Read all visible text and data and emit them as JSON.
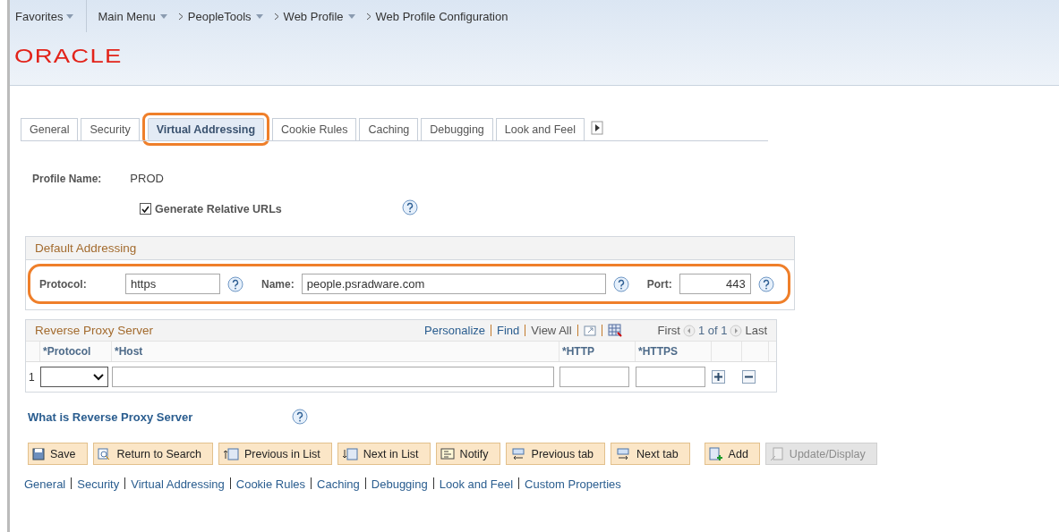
{
  "breadcrumb": {
    "favorites": "Favorites",
    "items": [
      {
        "label": "Main Menu",
        "dropdown": true
      },
      {
        "label": "PeopleTools",
        "dropdown": true
      },
      {
        "label": "Web Profile",
        "dropdown": true
      },
      {
        "label": "Web Profile Configuration",
        "dropdown": false
      }
    ]
  },
  "logo": "ORACLE",
  "tabs": [
    {
      "label": "General",
      "selected": false
    },
    {
      "label": "Security",
      "selected": false
    },
    {
      "label": "Virtual Addressing",
      "selected": true
    },
    {
      "label": "Cookie Rules",
      "selected": false
    },
    {
      "label": "Caching",
      "selected": false
    },
    {
      "label": "Debugging",
      "selected": false
    },
    {
      "label": "Look and Feel",
      "selected": false
    }
  ],
  "profile": {
    "label": "Profile Name:",
    "value": "PROD"
  },
  "relative_urls": {
    "label": "Generate Relative URLs",
    "checked": true
  },
  "default_addressing": {
    "title": "Default Addressing",
    "protocol_label": "Protocol:",
    "protocol": "https",
    "name_label": "Name:",
    "name": "people.psradware.com",
    "port_label": "Port:",
    "port": "443"
  },
  "proxy_grid": {
    "title": "Reverse Proxy Server",
    "links": [
      "Personalize",
      "Find",
      "View All"
    ],
    "first": "First",
    "count": "1 of 1",
    "last": "Last",
    "columns": [
      "*Protocol",
      "*Host",
      "*HTTP",
      "*HTTPS"
    ],
    "rows": [
      {
        "number": "1"
      }
    ]
  },
  "help_link": "What is Reverse Proxy Server",
  "buttons": [
    {
      "label": "Save",
      "kind": "save",
      "disabled": false
    },
    {
      "label": "Return to Search",
      "kind": "search",
      "disabled": false
    },
    {
      "label": "Previous in List",
      "kind": "prevlist",
      "disabled": false
    },
    {
      "label": "Next in List",
      "kind": "nextlist",
      "disabled": false
    },
    {
      "label": "Notify",
      "kind": "notify",
      "disabled": false
    },
    {
      "label": "Previous tab",
      "kind": "prevtab",
      "disabled": false
    },
    {
      "label": "Next tab",
      "kind": "nexttab",
      "disabled": false
    },
    {
      "label": "Add",
      "kind": "add",
      "disabled": false
    },
    {
      "label": "Update/Display",
      "kind": "update",
      "disabled": true
    }
  ],
  "footer_links": [
    "General",
    "Security",
    "Virtual Addressing",
    "Cookie Rules",
    "Caching",
    "Debugging",
    "Look and Feel",
    "Custom Properties"
  ]
}
